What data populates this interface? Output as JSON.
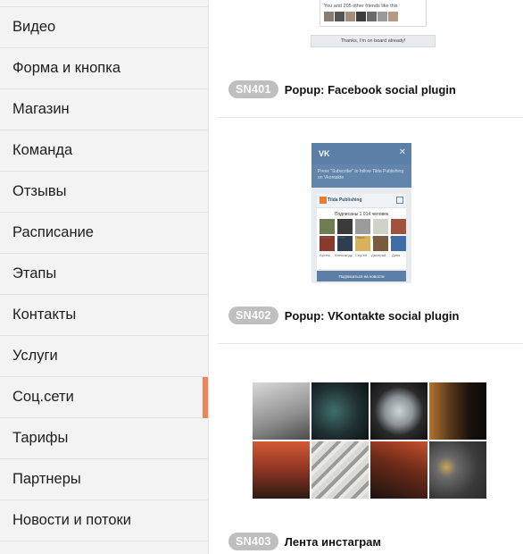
{
  "sidebar": {
    "items": [
      {
        "label": "Видео"
      },
      {
        "label": "Форма и кнопка"
      },
      {
        "label": "Магазин"
      },
      {
        "label": "Команда"
      },
      {
        "label": "Отзывы"
      },
      {
        "label": "Расписание"
      },
      {
        "label": "Этапы"
      },
      {
        "label": "Контакты"
      },
      {
        "label": "Услуги"
      },
      {
        "label": "Соц.сети",
        "active": true
      },
      {
        "label": "Тарифы"
      },
      {
        "label": "Партнеры"
      },
      {
        "label": "Новости и потоки"
      }
    ],
    "active_color": "#f0835a"
  },
  "blocks": [
    {
      "code": "SN401",
      "title": "Popup: Facebook social plugin",
      "preview": {
        "friends_text": "You and 205 other friends like this",
        "button_text": "Thanks, I'm on board already!"
      }
    },
    {
      "code": "SN402",
      "title": "Popup: VKontakte social plugin",
      "preview": {
        "prompt": "Press \"Subscribe\" to follow Tilda Publishing on Vkontakte",
        "page_name": "Tilda Publishing",
        "subscribers": "Подписаны 1 014 человек",
        "names": [
          "Роман",
          "Юля",
          "Паша",
          "Андрей",
          "Настя",
          "Артем",
          "Александр",
          "Сергей",
          "Дмитрий",
          "Даня"
        ],
        "subscribe_button": "Подписаться на новости"
      }
    },
    {
      "code": "SN403",
      "title": "Лента инстаграм"
    }
  ],
  "colors": {
    "badge_bg": "#bfbfbf",
    "vk_blue": "#5b7fa6"
  }
}
